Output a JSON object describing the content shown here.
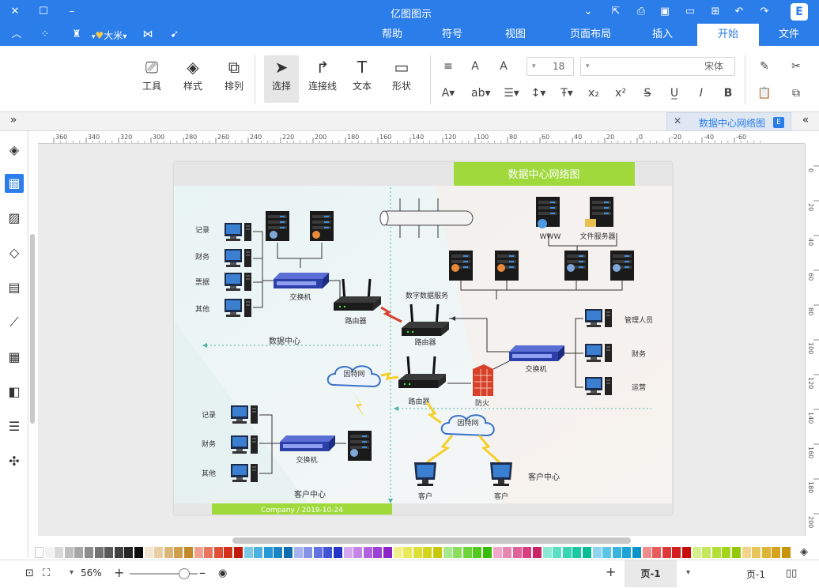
{
  "app": {
    "title": "亿图图示",
    "logo_letter": "E"
  },
  "menu": {
    "left_icons": [
      "chevron-up-icon",
      "apps-icon",
      "shirt-icon",
      "user-icon",
      "share-icon",
      "send-icon"
    ],
    "user_name": "大米",
    "tabs": [
      "文件",
      "开始",
      "插入",
      "页面布局",
      "视图",
      "符号",
      "帮助"
    ],
    "active_tab": "开始"
  },
  "ribbon": {
    "tools": [
      "形状",
      "文本",
      "连接线",
      "选择",
      "排列",
      "样式",
      "工具"
    ],
    "active_tool": "选择",
    "font_name": "宋体",
    "font_size": "18"
  },
  "document_tab": {
    "label": "数据中心网络图"
  },
  "ruler": {
    "h_ticks": [
      "360",
      "340",
      "320",
      "300",
      "280",
      "260",
      "240",
      "220",
      "200",
      "180",
      "160",
      "140",
      "120",
      "100",
      "80",
      "60",
      "40",
      "20",
      "0",
      "-20",
      "-40",
      "-60"
    ],
    "v_ticks": [
      "0",
      "20",
      "40",
      "60",
      "80",
      "100",
      "120",
      "140",
      "160",
      "180",
      "200"
    ]
  },
  "diagram": {
    "title": "数据中心网络图",
    "footer": "Company / 2019-10-24",
    "labels": {
      "dept1": "记录",
      "dept2": "财务",
      "dept3": "票据",
      "dept4": "其他",
      "switch1": "交换机",
      "router1": "路由器",
      "router2": "路由器",
      "router3": "路由器",
      "dc_label": "数据中心",
      "server_label": "数字数据服务",
      "www": "WWW",
      "fileserver": "文件服务器",
      "mgmt": "管理人员",
      "finance": "财务",
      "ops": "运营",
      "switch2": "交换机",
      "firewall": "防火",
      "cloud1": "因特网",
      "cloud2": "因特网",
      "dept5": "记录",
      "dept6": "财务",
      "dept7": "其他",
      "switch3": "交换机",
      "client_center": "客户中心",
      "client_center2": "客户中心",
      "client1": "客户",
      "client2": "客户"
    }
  },
  "palette": {
    "colors": [
      "#ffffff",
      "#f2f2f2",
      "#d9d9d9",
      "#bfbfbf",
      "#a6a6a6",
      "#8c8c8c",
      "#737373",
      "#595959",
      "#404040",
      "#262626",
      "#0d0d0d",
      "#f4e6d0",
      "#e8cfa3",
      "#dcb677",
      "#d09f4c",
      "#c48a2a",
      "#f0a08c",
      "#e8755c",
      "#de5138",
      "#d4321c",
      "#c01a0a",
      "#7ec8e8",
      "#4fb1df",
      "#2898d6",
      "#1b84c2",
      "#0f6fad",
      "#a8b4f0",
      "#8593e8",
      "#6272df",
      "#4052d6",
      "#2435c8",
      "#d6a8f0",
      "#c385e8",
      "#b062df",
      "#9d40d6",
      "#8a24c8",
      "#f0f08c",
      "#e8e85c",
      "#dede38",
      "#d4d41c",
      "#c8c80a",
      "#a8e88c",
      "#8ade5c",
      "#6cd438",
      "#50c81c",
      "#38bc0a",
      "#f0a8c8",
      "#e885b0",
      "#df6298",
      "#d64080",
      "#c82468",
      "#8ce8d4",
      "#5cdec4",
      "#38d4b4",
      "#1cc8a4",
      "#0abc94",
      "#8cd4f0",
      "#5cc4e8",
      "#38b4df",
      "#1ca4d6",
      "#0a94c8",
      "#f08c8c",
      "#e85c5c",
      "#de3838",
      "#d41c1c",
      "#c80a0a",
      "#d4f08c",
      "#c4e85c",
      "#b4de38",
      "#a4d41c",
      "#94c80a",
      "#f0d48c",
      "#e8c45c",
      "#deb438",
      "#d4a41c",
      "#c8940a"
    ]
  },
  "status": {
    "page_label": "页-1",
    "page_tab": "页-1",
    "add_page": "+",
    "zoom": "56%"
  }
}
